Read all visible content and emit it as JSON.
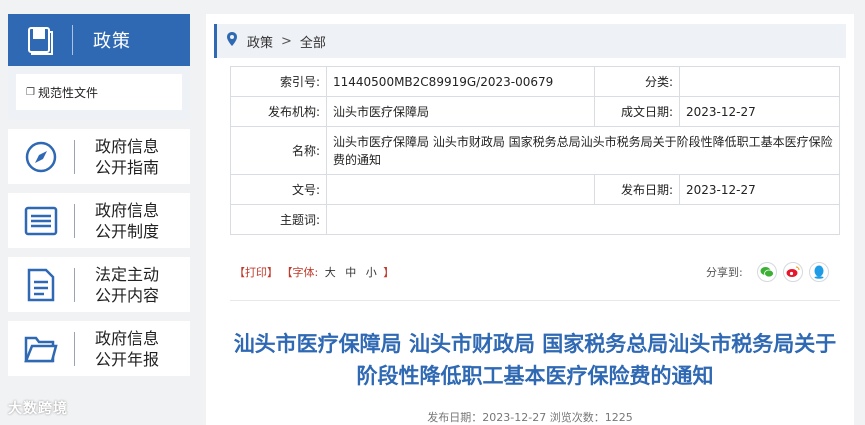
{
  "sidebar": {
    "policy_label": "政策",
    "sub_item": "规范性文件",
    "items": [
      {
        "label1": "政府信息",
        "label2": "公开指南"
      },
      {
        "label1": "政府信息",
        "label2": "公开制度"
      },
      {
        "label1": "法定主动",
        "label2": "公开内容"
      },
      {
        "label1": "政府信息",
        "label2": "公开年报"
      }
    ]
  },
  "breadcrumb": {
    "first": "政策",
    "second": "全部"
  },
  "meta": {
    "index_label": "索引号:",
    "index_value": "11440500MB2C89919G/2023-00679",
    "category_label": "分类:",
    "category_value": "",
    "org_label": "发布机构:",
    "org_value": "汕头市医疗保障局",
    "date_made_label": "成文日期:",
    "date_made_value": "2023-12-27",
    "name_label": "名称:",
    "name_value": "汕头市医疗保障局 汕头市财政局 国家税务总局汕头市税务局关于阶段性降低职工基本医疗保险费的通知",
    "doc_no_label": "文号:",
    "doc_no_value": "",
    "pub_date_label": "发布日期:",
    "pub_date_value": "2023-12-27",
    "subject_label": "主题词:",
    "subject_value": ""
  },
  "tools": {
    "print": "【打印】",
    "font_prefix": "【字体:",
    "large": "大",
    "medium": "中",
    "small": "小",
    "font_suffix": "】"
  },
  "share": {
    "label": "分享到:"
  },
  "article": {
    "title": "汕头市医疗保障局 汕头市财政局 国家税务总局汕头市税务局关于阶段性降低职工基本医疗保险费的通知",
    "pub_line": "发布日期：2023-12-27  浏览次数：1225"
  },
  "watermark": "大数跨境",
  "colors": {
    "accent": "#2f69b3",
    "bg": "#f1f2f4"
  }
}
